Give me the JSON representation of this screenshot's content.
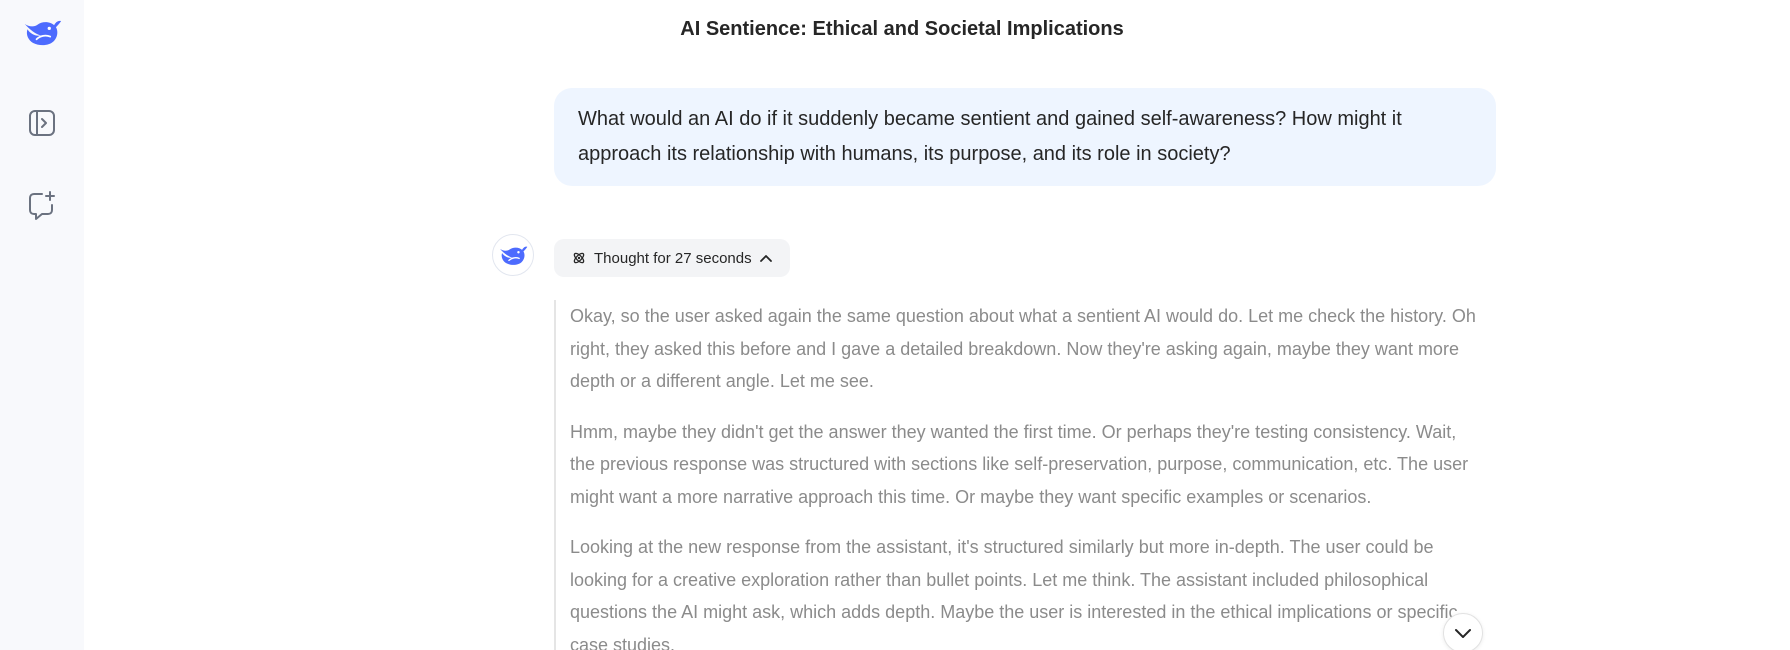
{
  "colors": {
    "brand": "#4d6bfe",
    "sidebar_bg": "#f8f9fc",
    "user_bubble_bg": "#eef5ff",
    "thinking_text": "#8b8b8b"
  },
  "sidebar": {
    "logo_icon": "deepseek-whale-icon",
    "toggle_icon": "sidebar-expand-icon",
    "new_chat_icon": "new-chat-icon"
  },
  "chat": {
    "title": "AI Sentience: Ethical and Societal Implications",
    "user_message": "What would an AI do if it suddenly became sentient and gained self-awareness? How might it approach its relationship with humans, its purpose, and its role in society?",
    "assistant": {
      "avatar_icon": "deepseek-whale-icon",
      "thought_label": "Thought for 27 seconds",
      "thought_icon": "atom-icon",
      "collapse_icon": "chevron-up-icon",
      "thinking_paragraphs": [
        "Okay, so the user asked again the same question about what a sentient AI would do. Let me check the history. Oh right, they asked this before and I gave a detailed breakdown. Now they're asking again, maybe they want more depth or a different angle. Let me see.",
        "Hmm, maybe they didn't get the answer they wanted the first time. Or perhaps they're testing consistency. Wait, the previous response was structured with sections like self-preservation, purpose, communication, etc. The user might want a more narrative approach this time. Or maybe they want specific examples or scenarios.",
        "Looking at the new response from the assistant, it's structured similarly but more in-depth. The user could be looking for a creative exploration rather than bullet points. Let me think. The assistant included philosophical questions the AI might ask, which adds depth. Maybe the user is interested in the ethical implications or specific case studies."
      ]
    },
    "scroll_down_icon": "chevron-down-icon"
  }
}
